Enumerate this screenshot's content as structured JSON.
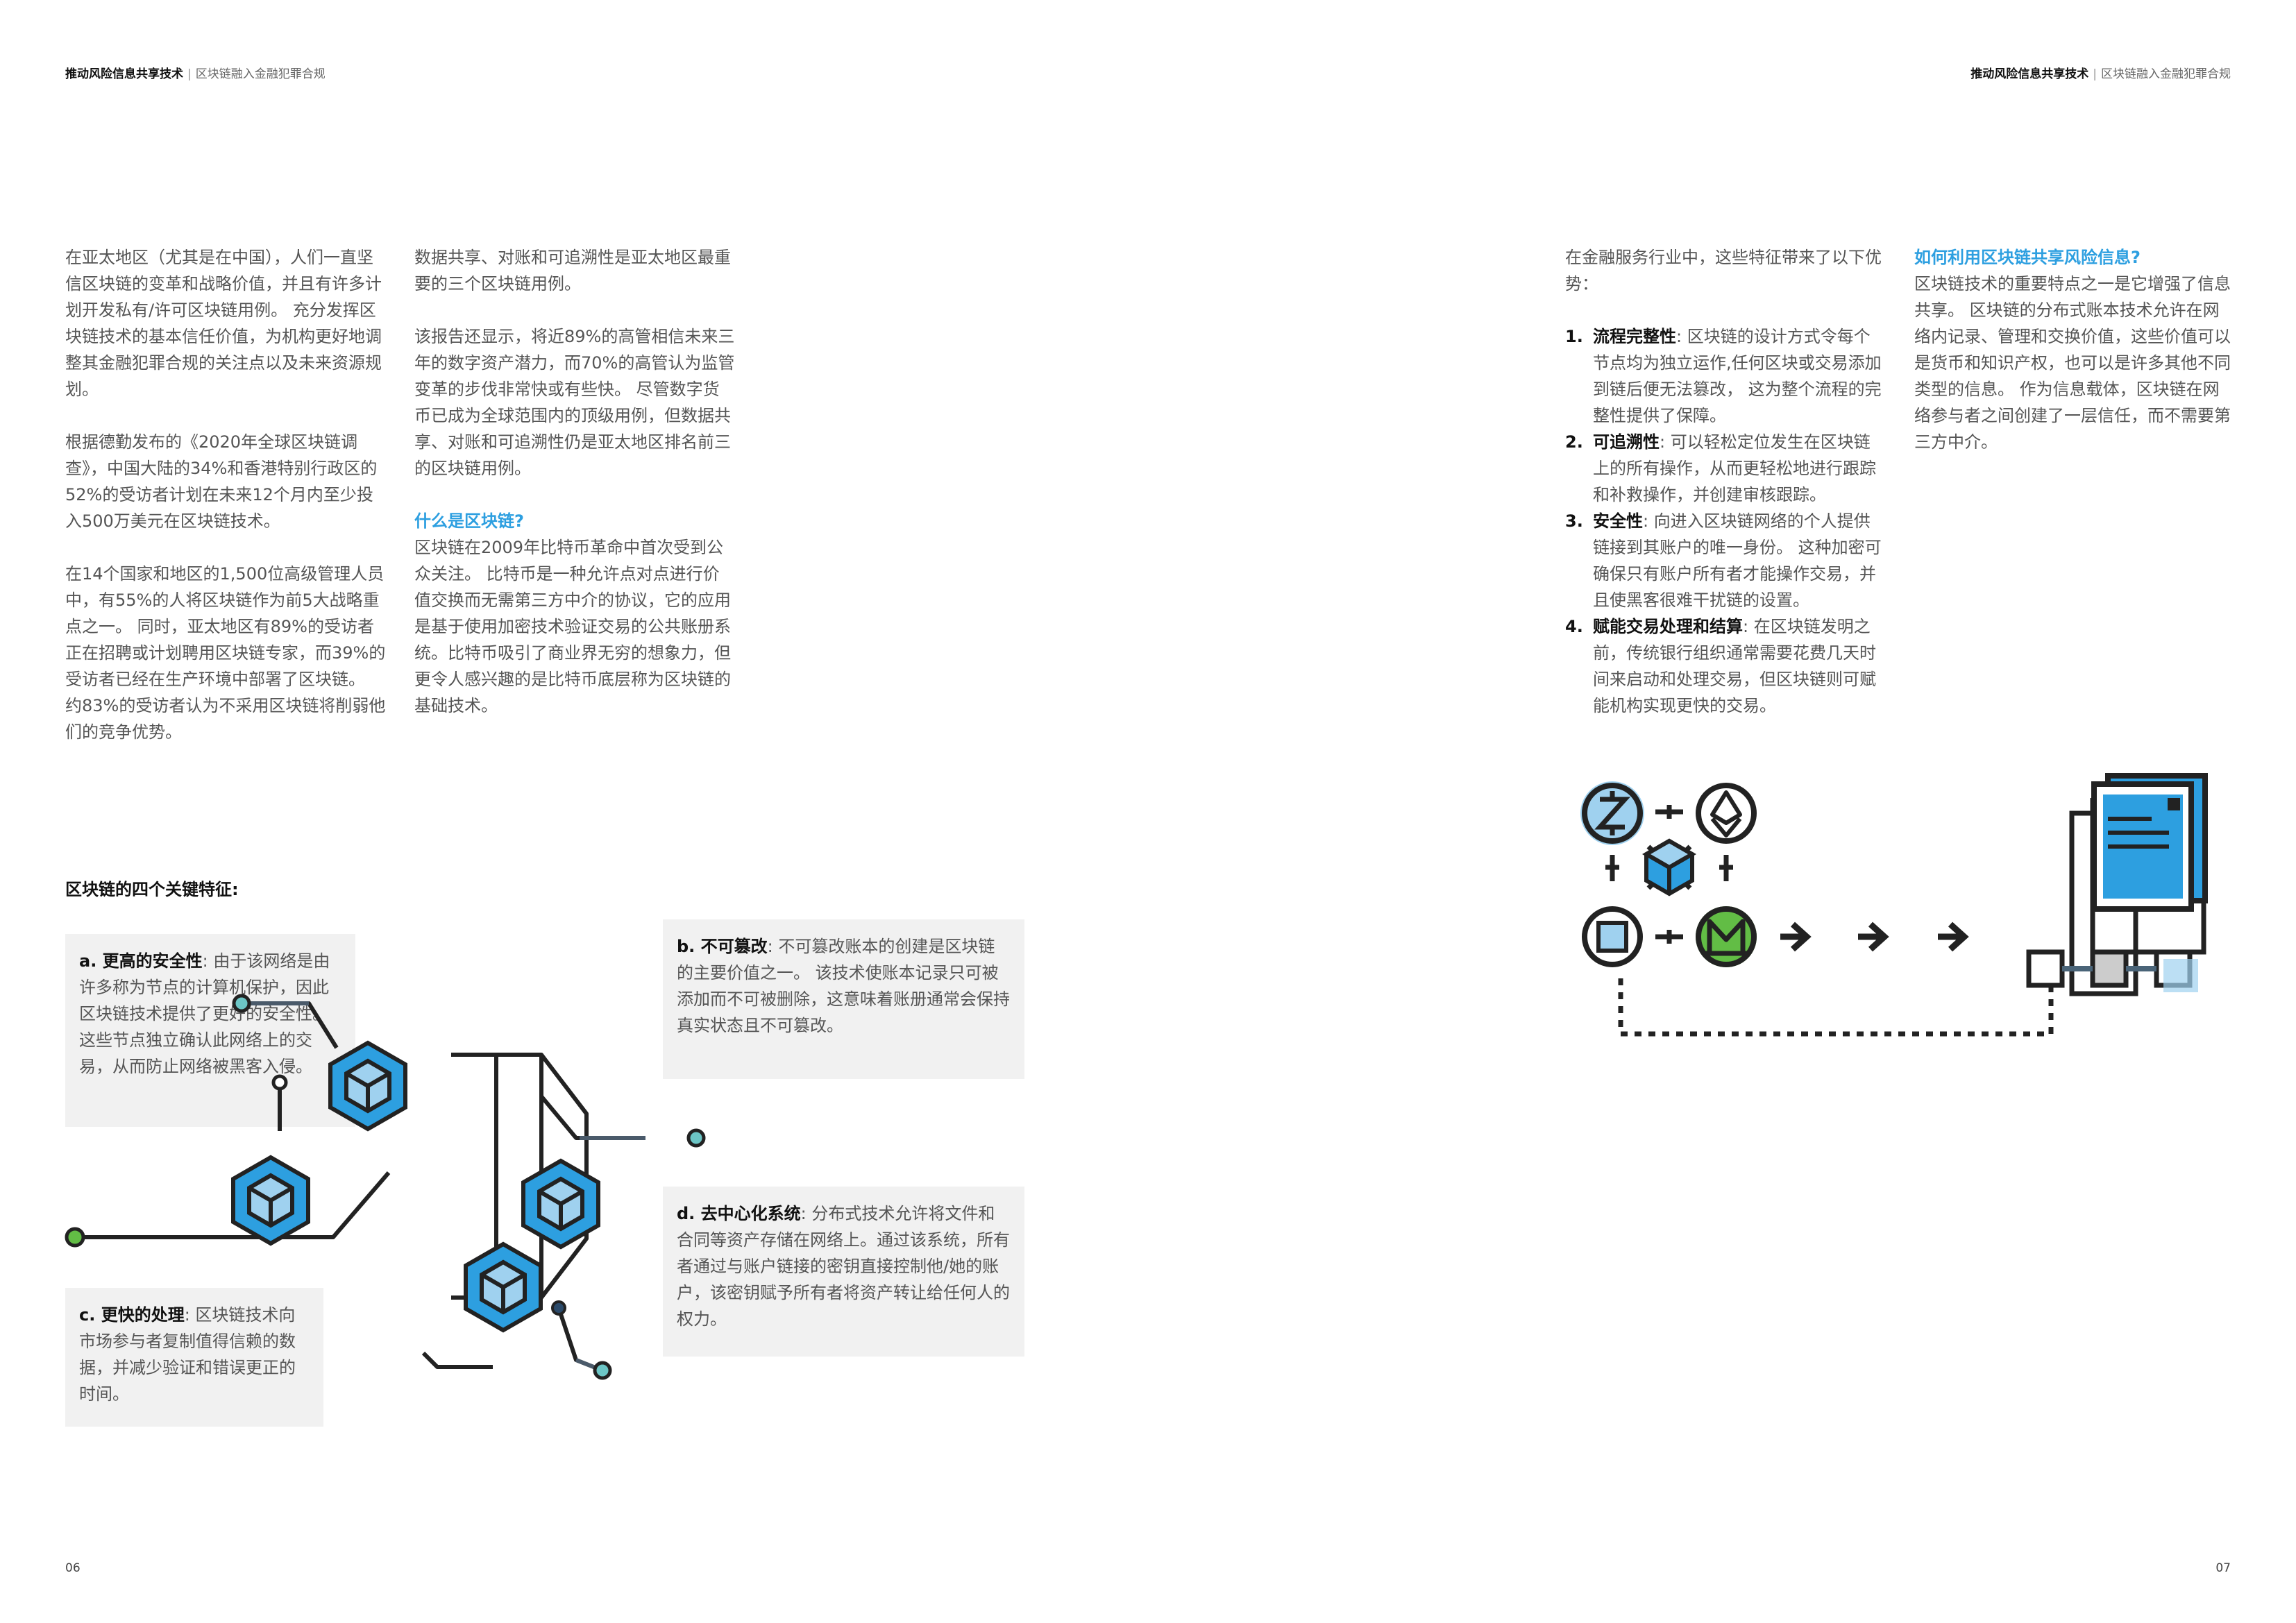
{
  "header": {
    "left_bold": "推动风险信息共享技术",
    "left_light": "区块链融入金融犯罪合规",
    "right_bold": "推动风险信息共享技术",
    "right_light": "区块链融入金融犯罪合规",
    "separator": "|"
  },
  "col1": {
    "p1": "在亚太地区（尤其是在中国），人们一直坚信区块链的变革和战略价值，并且有许多计划开发私有/许可区块链用例。 充分发挥区块链技术的基本信任价值，为机构更好地调整其金融犯罪合规的关注点以及未来资源规划。",
    "p2": "根据德勤发布的《2020年全球区块链调查》，中国大陆的34%和香港特别行政区的52%的受访者计划在未来12个月内至少投入500万美元在区块链技术。",
    "p3": "在14个国家和地区的1,500位高级管理人员中，有55%的人将区块链作为前5大战略重点之一。 同时，亚太地区有89%的受访者正在招聘或计划聘用区块链专家，而39%的受访者已经在生产环境中部署了区块链。 约83%的受访者认为不采用区块链将削弱他们的竞争优势。"
  },
  "col2": {
    "p1": "数据共享、对账和可追溯性是亚太地区最重要的三个区块链用例。",
    "p2": "该报告还显示，将近89%的高管相信未来三年的数字资产潜力，而70%的高管认为监管变革的步伐非常快或有些快。 尽管数字货币已成为全球范围内的顶级用例，但数据共享、对账和可追溯性仍是亚太地区排名前三的区块链用例。",
    "heading": "什么是区块链?",
    "p3": "区块链在2009年比特币革命中首次受到公众关注。 比特币是一种允许点对点进行价值交换而无需第三方中介的协议，它的应用是基于使用加密技术验证交易的公共账册系统。比特币吸引了商业界无穷的想象力，但更令人感兴趣的是比特币底层称为区块链的基础技术。"
  },
  "features": {
    "title": "区块链的四个关键特征:",
    "a_title": "a. 更高的安全性",
    "a_text": ": 由于该网络是由许多称为节点的计算机保护，因此区块链技术提供了更好的安全性。 这些节点独立确认此网络上的交易，从而防止网络被黑客入侵。",
    "b_title": "b. 不可篡改",
    "b_text": ": 不可篡改账本的创建是区块链的主要价值之一。 该技术使账本记录只可被添加而不可被删除，这意味着账册通常会保持真实状态且不可篡改。",
    "c_title": "c. 更快的处理",
    "c_text": ": 区块链技术向市场参与者复制值得信赖的数据，并减少验证和错误更正的时间。",
    "d_title": "d. 去中心化系统",
    "d_text": ": 分布式技术允许将文件和合同等资产存储在网络上。通过该系统，所有者通过与账户链接的密钥直接控制他/她的账户，该密钥赋予所有者将资产转让给任何人的权力。"
  },
  "col3": {
    "intro": "在金融服务行业中，这些特征带来了以下优势：",
    "items": [
      {
        "n": "1.",
        "title": "流程完整性",
        "text": ": 区块链的设计方式令每个节点均为独立运作,任何区块或交易添加到链后便无法篡改， 这为整个流程的完整性提供了保障。"
      },
      {
        "n": "2.",
        "title": "可追溯性",
        "text": ": 可以轻松定位发生在区块链上的所有操作，从而更轻松地进行跟踪和补救操作，并创建审核跟踪。"
      },
      {
        "n": "3.",
        "title": "安全性",
        "text": ": 向进入区块链网络的个人提供链接到其账户的唯一身份。 这种加密可确保只有账户所有者才能操作交易，并且使黑客很难干扰链的设置。"
      },
      {
        "n": "4.",
        "title": "赋能交易处理和结算",
        "text": ": 在区块链发明之前，传统银行组织通常需要花费几天时间来启动和处理交易，但区块链则可赋能机构实现更快的交易。"
      }
    ]
  },
  "col4": {
    "heading": "如何利用区块链共享风险信息?",
    "p1": "区块链技术的重要特点之一是它增强了信息共享。 区块链的分布式账本技术允许在网络内记录、管理和交换价值，这些价值可以是货币和知识产权，也可以是许多其他不同类型的信息。 作为信息载体，区块链在网络参与者之间创建了一层信任，而不需要第三方中介。"
  },
  "colors": {
    "accent": "#2d9fe0",
    "green": "#62bd45",
    "light_blue": "#9fd1ef",
    "box_bg": "#f1f1f1"
  },
  "icons": [
    "zcash-coin-icon",
    "ethereum-coin-icon",
    "monero-coin-icon",
    "square-coin-icon",
    "arrow-right-icon",
    "document-icon",
    "blockchain-cubes-icon"
  ],
  "footer": {
    "left_page": "06",
    "right_page": "07"
  }
}
